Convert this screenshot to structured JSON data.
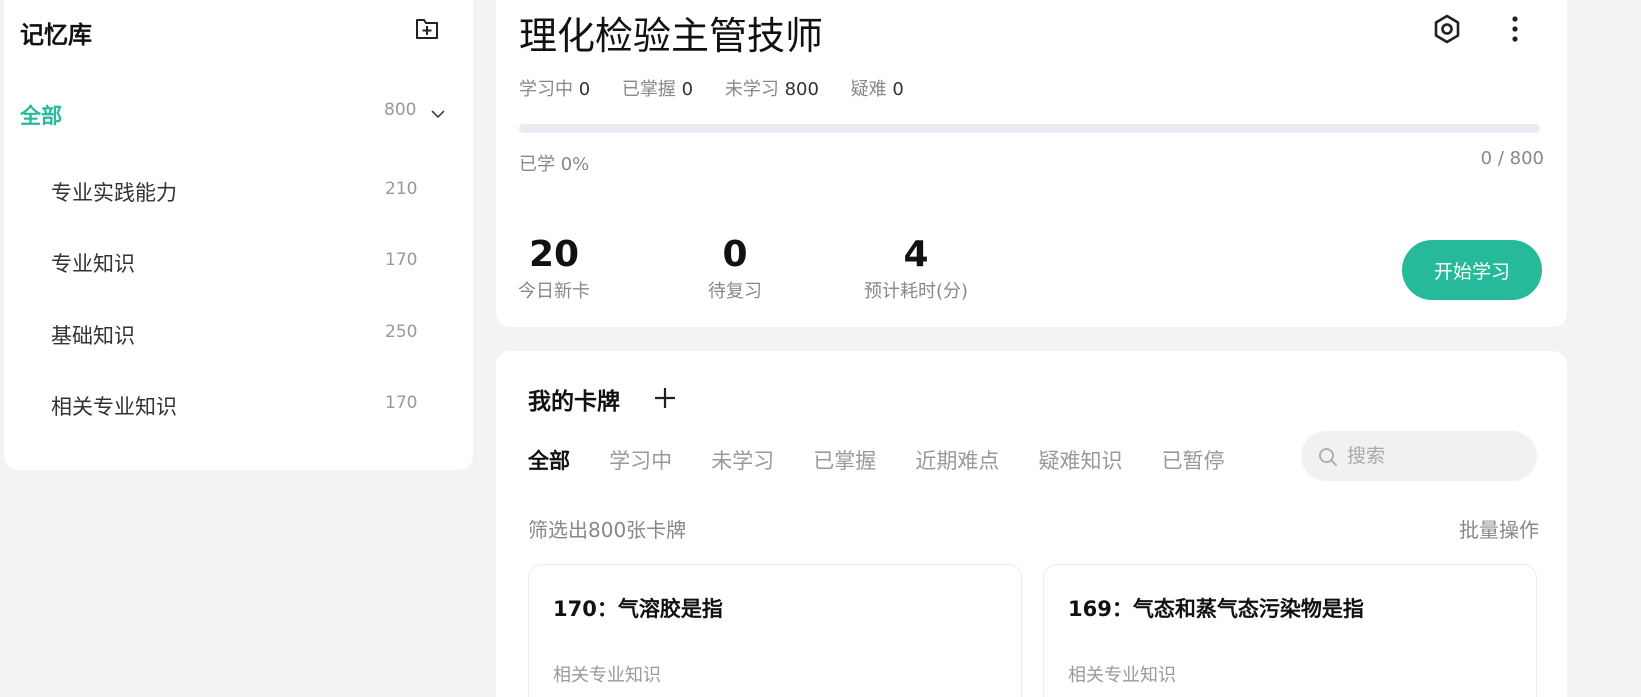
{
  "sidebar": {
    "title": "记忆库",
    "all": {
      "label": "全部",
      "count": "800"
    },
    "items": [
      {
        "label": "专业实践能力",
        "count": "210"
      },
      {
        "label": "专业知识",
        "count": "170"
      },
      {
        "label": "基础知识",
        "count": "250"
      },
      {
        "label": "相关专业知识",
        "count": "170"
      }
    ]
  },
  "deck": {
    "title": "理化检验主管技师",
    "stats": [
      {
        "label": "学习中",
        "value": "0"
      },
      {
        "label": "已掌握",
        "value": "0"
      },
      {
        "label": "未学习",
        "value": "800"
      },
      {
        "label": "疑难",
        "value": "0"
      }
    ],
    "progress_fraction": 0,
    "progress_label": "已学 0%",
    "progress_count": "0 / 800",
    "metrics": [
      {
        "value": "20",
        "label": "今日新卡"
      },
      {
        "value": "0",
        "label": "待复习"
      },
      {
        "value": "4",
        "label": "预计耗时(分)"
      }
    ],
    "start_button": "开始学习"
  },
  "cards": {
    "title": "我的卡牌",
    "tabs": [
      "全部",
      "学习中",
      "未学习",
      "已掌握",
      "近期难点",
      "疑难知识",
      "已暂停"
    ],
    "active_tab": "全部",
    "search_placeholder": "搜索",
    "filter_text": "筛选出800张卡牌",
    "batch_label": "批量操作",
    "list": [
      {
        "title": "170：气溶胶是指",
        "subject": "相关专业知识"
      },
      {
        "title": "169：气态和蒸气态污染物是指",
        "subject": "相关专业知识"
      }
    ]
  },
  "colors": {
    "accent": "#26b99a",
    "progress_track": "#e9ebf3",
    "background": "#f3f3f3"
  },
  "icons": {
    "add_deck": "add-square-icon",
    "collapse": "chevron-down-icon",
    "settings": "settings-hexagon-icon",
    "more": "more-vertical-icon",
    "add_card": "plus-icon",
    "search": "search-icon"
  }
}
